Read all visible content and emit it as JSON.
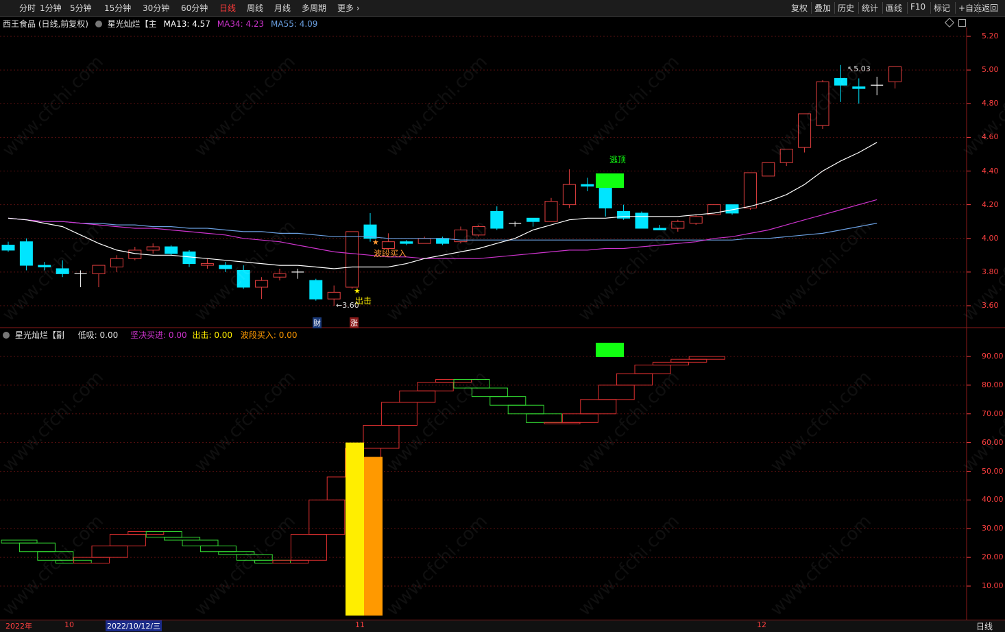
{
  "toolbar": {
    "periods": [
      "分时",
      "1分钟",
      "5分钟",
      "15分钟",
      "30分钟",
      "60分钟",
      "日线",
      "周线",
      "月线",
      "多周期",
      "更多 ›"
    ],
    "active_period": "日线",
    "right_buttons": [
      "复权",
      "叠加",
      "历史",
      "统计",
      "画线",
      "F10",
      "标记",
      "+自选",
      "返回"
    ]
  },
  "main_panel": {
    "stock_title": "西王食品 (日线,前复权)",
    "indicator_name": "星光灿烂【主",
    "ma13_label": "MA13: 4.57",
    "ma34_label": "MA34: 4.23",
    "ma55_label": "MA55: 4.09",
    "y_ticks": [
      "5.20",
      "5.00",
      "4.80",
      "4.60",
      "4.40",
      "4.20",
      "4.00",
      "3.80",
      "3.60"
    ],
    "high_label": "5.03",
    "low_label": "3.60",
    "annotations": {
      "buy_wave": "波段买入",
      "exit": "出击",
      "escape_top": "逃顶",
      "cai": "财",
      "zhang": "涨"
    }
  },
  "sub_panel": {
    "indicator_name": "星光灿烂【副",
    "low_buy_label": "低吸: 0.00",
    "firm_buy_label": "坚决买进: 0.00",
    "exit_label": "出击: 0.00",
    "wave_buy_label": "波段买入: 0.00",
    "y_ticks": [
      "90.00",
      "80.00",
      "70.00",
      "60.00",
      "50.00",
      "40.00",
      "30.00",
      "20.00",
      "10.00"
    ]
  },
  "bottom_axis": {
    "labels": [
      "2022年",
      "10",
      "2022/10/12/三",
      "11",
      "12"
    ],
    "period_button": "日线"
  },
  "watermark": "www.cfchi.com",
  "colors": {
    "up": "#e84040",
    "down": "#00e5ff",
    "ma13": "#ffffff",
    "ma34": "#cc33cc",
    "ma55": "#6a9fe0",
    "escape": "#11ff11",
    "axis": "#ff4040"
  },
  "chart_data": [
    {
      "type": "candlestick",
      "title": "西王食品 (日线,前复权)",
      "ylim": [
        3.5,
        5.25
      ],
      "candles": [
        {
          "o": 3.96,
          "h": 3.98,
          "l": 3.92,
          "c": 3.93
        },
        {
          "o": 3.98,
          "h": 4.0,
          "l": 3.81,
          "c": 3.84
        },
        {
          "o": 3.84,
          "h": 3.86,
          "l": 3.81,
          "c": 3.83
        },
        {
          "o": 3.82,
          "h": 3.87,
          "l": 3.77,
          "c": 3.79
        },
        {
          "o": 3.79,
          "h": 3.81,
          "l": 3.71,
          "c": 3.79
        },
        {
          "o": 3.79,
          "h": 3.84,
          "l": 3.71,
          "c": 3.84
        },
        {
          "o": 3.83,
          "h": 3.9,
          "l": 3.8,
          "c": 3.88
        },
        {
          "o": 3.88,
          "h": 3.95,
          "l": 3.87,
          "c": 3.93
        },
        {
          "o": 3.93,
          "h": 3.97,
          "l": 3.91,
          "c": 3.95
        },
        {
          "o": 3.95,
          "h": 3.96,
          "l": 3.9,
          "c": 3.91
        },
        {
          "o": 3.92,
          "h": 3.93,
          "l": 3.83,
          "c": 3.85
        },
        {
          "o": 3.84,
          "h": 3.88,
          "l": 3.82,
          "c": 3.85
        },
        {
          "o": 3.84,
          "h": 3.86,
          "l": 3.8,
          "c": 3.82
        },
        {
          "o": 3.81,
          "h": 3.84,
          "l": 3.7,
          "c": 3.71
        },
        {
          "o": 3.71,
          "h": 3.77,
          "l": 3.64,
          "c": 3.75
        },
        {
          "o": 3.77,
          "h": 3.82,
          "l": 3.75,
          "c": 3.79
        },
        {
          "o": 3.8,
          "h": 3.82,
          "l": 3.76,
          "c": 3.8
        },
        {
          "o": 3.75,
          "h": 3.76,
          "l": 3.63,
          "c": 3.64
        },
        {
          "o": 3.64,
          "h": 3.72,
          "l": 3.6,
          "c": 3.68
        },
        {
          "o": 3.71,
          "h": 4.04,
          "l": 3.7,
          "c": 4.04
        },
        {
          "o": 4.08,
          "h": 4.15,
          "l": 3.98,
          "c": 4.0
        },
        {
          "o": 3.94,
          "h": 4.03,
          "l": 3.93,
          "c": 3.98
        },
        {
          "o": 3.98,
          "h": 3.99,
          "l": 3.96,
          "c": 3.97
        },
        {
          "o": 3.97,
          "h": 4.01,
          "l": 3.97,
          "c": 4.0
        },
        {
          "o": 4.0,
          "h": 4.01,
          "l": 3.96,
          "c": 3.97
        },
        {
          "o": 3.98,
          "h": 4.07,
          "l": 3.97,
          "c": 4.05
        },
        {
          "o": 4.02,
          "h": 4.08,
          "l": 4.01,
          "c": 4.07
        },
        {
          "o": 4.16,
          "h": 4.19,
          "l": 4.05,
          "c": 4.06
        },
        {
          "o": 4.09,
          "h": 4.1,
          "l": 4.07,
          "c": 4.09
        },
        {
          "o": 4.12,
          "h": 4.12,
          "l": 4.07,
          "c": 4.1
        },
        {
          "o": 4.1,
          "h": 4.24,
          "l": 4.1,
          "c": 4.22
        },
        {
          "o": 4.2,
          "h": 4.41,
          "l": 4.18,
          "c": 4.32
        },
        {
          "o": 4.32,
          "h": 4.36,
          "l": 4.28,
          "c": 4.31
        },
        {
          "o": 4.3,
          "h": 4.31,
          "l": 4.13,
          "c": 4.18
        },
        {
          "o": 4.16,
          "h": 4.2,
          "l": 4.11,
          "c": 4.12
        },
        {
          "o": 4.15,
          "h": 4.16,
          "l": 4.06,
          "c": 4.06
        },
        {
          "o": 4.06,
          "h": 4.08,
          "l": 4.05,
          "c": 4.05
        },
        {
          "o": 4.06,
          "h": 4.11,
          "l": 4.04,
          "c": 4.1
        },
        {
          "o": 4.09,
          "h": 4.14,
          "l": 4.08,
          "c": 4.13
        },
        {
          "o": 4.14,
          "h": 4.2,
          "l": 4.14,
          "c": 4.2
        },
        {
          "o": 4.2,
          "h": 4.2,
          "l": 4.14,
          "c": 4.15
        },
        {
          "o": 4.18,
          "h": 4.39,
          "l": 4.17,
          "c": 4.39
        },
        {
          "o": 4.37,
          "h": 4.45,
          "l": 4.37,
          "c": 4.45
        },
        {
          "o": 4.45,
          "h": 4.53,
          "l": 4.43,
          "c": 4.53
        },
        {
          "o": 4.54,
          "h": 4.74,
          "l": 4.51,
          "c": 4.74
        },
        {
          "o": 4.67,
          "h": 4.94,
          "l": 4.65,
          "c": 4.93
        },
        {
          "o": 4.95,
          "h": 5.03,
          "l": 4.81,
          "c": 4.91
        },
        {
          "o": 4.9,
          "h": 4.95,
          "l": 4.8,
          "c": 4.89
        },
        {
          "o": 4.91,
          "h": 4.96,
          "l": 4.85,
          "c": 4.91
        },
        {
          "o": 4.93,
          "h": 5.02,
          "l": 4.89,
          "c": 5.02
        }
      ],
      "ma13": [
        4.12,
        4.11,
        4.09,
        4.07,
        4.02,
        3.97,
        3.93,
        3.91,
        3.9,
        3.9,
        3.89,
        3.88,
        3.87,
        3.86,
        3.85,
        3.84,
        3.84,
        3.83,
        3.82,
        3.83,
        3.83,
        3.83,
        3.85,
        3.88,
        3.9,
        3.92,
        3.94,
        3.97,
        4.0,
        4.05,
        4.08,
        4.11,
        4.12,
        4.12,
        4.13,
        4.13,
        4.13,
        4.13,
        4.14,
        4.15,
        4.17,
        4.19,
        4.22,
        4.26,
        4.32,
        4.4,
        4.46,
        4.51,
        4.57
      ],
      "ma34": [
        4.12,
        4.11,
        4.1,
        4.1,
        4.09,
        4.08,
        4.07,
        4.06,
        4.06,
        4.05,
        4.04,
        4.03,
        4.02,
        4.0,
        3.99,
        3.98,
        3.96,
        3.94,
        3.92,
        3.91,
        3.9,
        3.89,
        3.89,
        3.88,
        3.88,
        3.88,
        3.88,
        3.89,
        3.9,
        3.91,
        3.92,
        3.93,
        3.93,
        3.94,
        3.94,
        3.95,
        3.96,
        3.97,
        3.98,
        4.0,
        4.01,
        4.03,
        4.05,
        4.08,
        4.11,
        4.14,
        4.17,
        4.2,
        4.23
      ],
      "ma55": [
        4.12,
        4.11,
        4.1,
        4.1,
        4.09,
        4.09,
        4.08,
        4.08,
        4.07,
        4.07,
        4.06,
        4.06,
        4.05,
        4.04,
        4.04,
        4.03,
        4.03,
        4.02,
        4.01,
        4.01,
        4.01,
        4.0,
        4.0,
        4.0,
        4.0,
        3.99,
        3.99,
        3.99,
        3.99,
        3.99,
        3.99,
        3.99,
        3.99,
        3.99,
        3.99,
        3.99,
        3.99,
        3.99,
        3.99,
        3.99,
        3.99,
        4.0,
        4.0,
        4.01,
        4.02,
        4.03,
        4.05,
        4.07,
        4.09
      ]
    },
    {
      "type": "bar",
      "title": "星光灿烂【副",
      "ylim": [
        0,
        100
      ],
      "strength": [
        26,
        25,
        22,
        19,
        18,
        20,
        24,
        28,
        29,
        27,
        26,
        24,
        22,
        21,
        19,
        18,
        19,
        28,
        40,
        48,
        58,
        66,
        74,
        78,
        81,
        82,
        79,
        76,
        73,
        70,
        67,
        67,
        70,
        75,
        80,
        84,
        87,
        88,
        89,
        90
      ],
      "strength_start_index": 0,
      "exit_bar": 60,
      "wave_buy_bar": 55
    }
  ]
}
